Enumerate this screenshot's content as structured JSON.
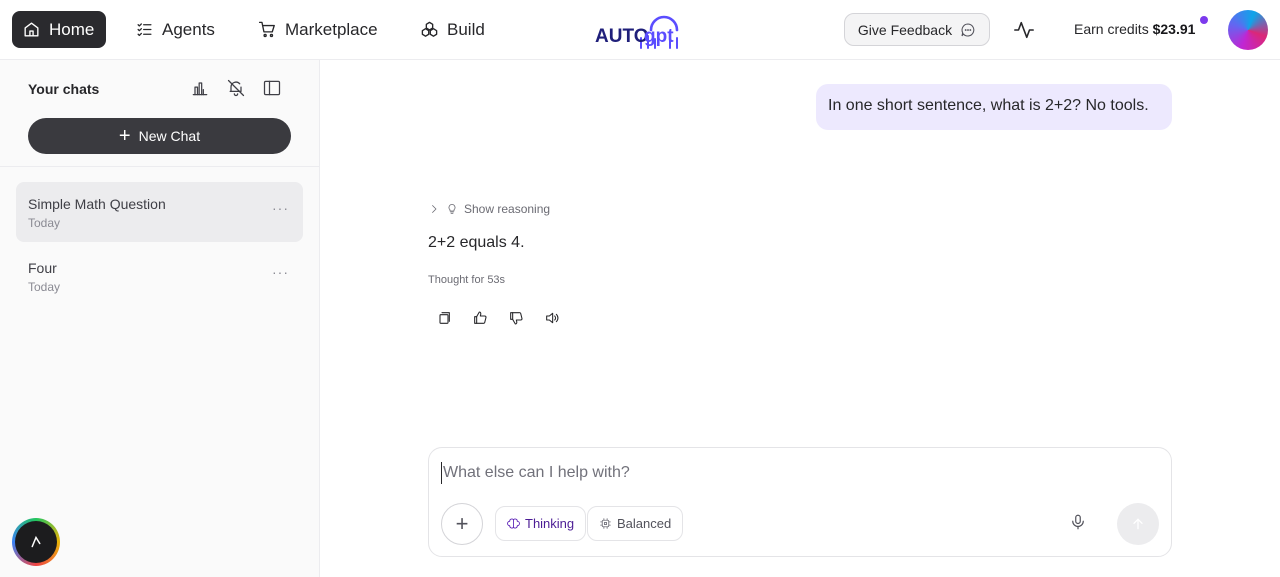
{
  "nav": {
    "home": "Home",
    "agents": "Agents",
    "marketplace": "Marketplace",
    "build": "Build"
  },
  "logo": {
    "text_top": "AUTO",
    "text_brand": "gpt"
  },
  "header": {
    "feedback_label": "Give Feedback",
    "credits_label": "Earn credits",
    "credits_value": "$23.91"
  },
  "sidebar": {
    "heading": "Your chats",
    "new_chat_label": "New Chat",
    "chats": [
      {
        "title": "Simple Math Question",
        "date": "Today",
        "active": true
      },
      {
        "title": "Four",
        "date": "Today",
        "active": false
      }
    ]
  },
  "conversation": {
    "user_message": "In one short sentence, what is 2+2? No tools.",
    "reasoning_toggle": "Show reasoning",
    "assistant_message": "2+2 equals 4.",
    "thought_duration": "Thought for 53s"
  },
  "composer": {
    "placeholder": "What else can I help with?",
    "value": "",
    "thinking_label": "Thinking",
    "balanced_label": "Balanced"
  },
  "colors": {
    "accent": "#7c3aed",
    "user_bubble": "#ede9fe",
    "nav_active": "#2a2a2e",
    "new_chat_button": "#3a3a3f"
  },
  "icons": {
    "nav": [
      "home-icon",
      "agents-icon",
      "cart-icon",
      "build-icon"
    ],
    "header": [
      "chat-bubble-icon",
      "activity-icon"
    ],
    "sidebar": [
      "chart-icon",
      "bell-off-icon",
      "panel-icon"
    ],
    "message_actions": [
      "copy-icon",
      "thumbs-up-icon",
      "thumbs-down-icon",
      "speaker-icon"
    ],
    "composer": [
      "plus-icon",
      "thinking-icon",
      "balanced-icon",
      "mic-icon",
      "send-icon"
    ]
  }
}
